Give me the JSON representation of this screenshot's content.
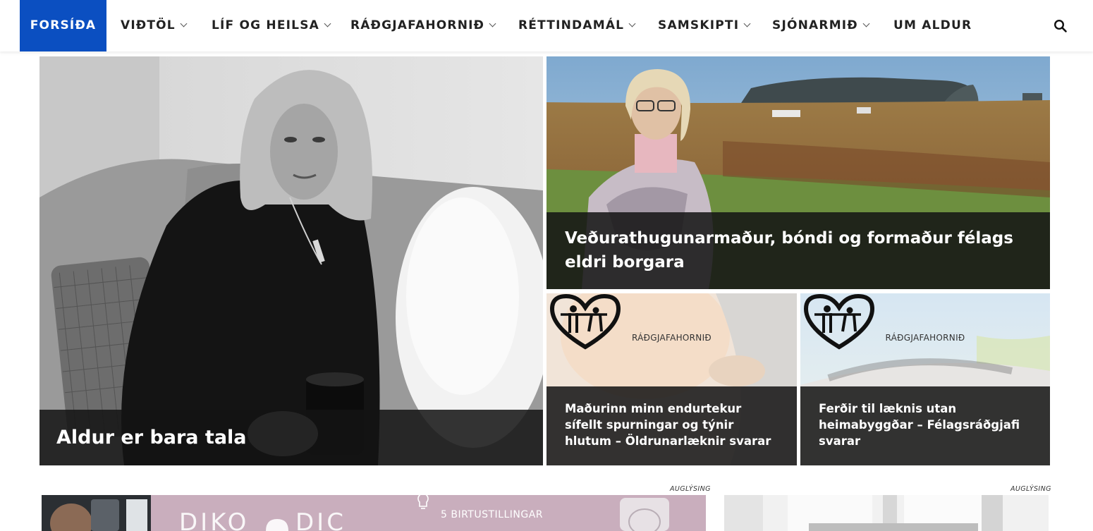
{
  "nav": {
    "items": [
      {
        "label": "FORSÍÐA"
      },
      {
        "label": "VIÐTÖL"
      },
      {
        "label": "LÍF OG HEILSA"
      },
      {
        "label": "RÁÐGJAFAHORNIÐ"
      },
      {
        "label": "RÉTTINDAMÁL"
      },
      {
        "label": "SAMSKIPTI"
      },
      {
        "label": "SJÓNARMIÐ"
      },
      {
        "label": "UM ALDUR"
      }
    ],
    "search_icon": "search-icon",
    "accent": "#0b4fc1"
  },
  "featured": {
    "main": {
      "title": "Aldur er bara tala"
    },
    "top_right": {
      "title": "Veðurathugunarmaður, bóndi og formaður félags eldri borgara"
    },
    "bottom_left": {
      "category": "RÁÐGJAFAHORNIÐ",
      "title": "Maðurinn minn endurtekur sífellt spurningar og týnir hlutum – Öldrunarlæknir svarar"
    },
    "bottom_right": {
      "category": "RÁÐGJAFAHORNIÐ",
      "title": "Ferðir til læknis utan heimabyggðar – Félagsráðgjafi svarar"
    }
  },
  "ads": {
    "left_label": "AUGLÝSING",
    "right_label": "AUGLÝSING",
    "banner_text": "5 BIRTUSTILLINGAR"
  }
}
